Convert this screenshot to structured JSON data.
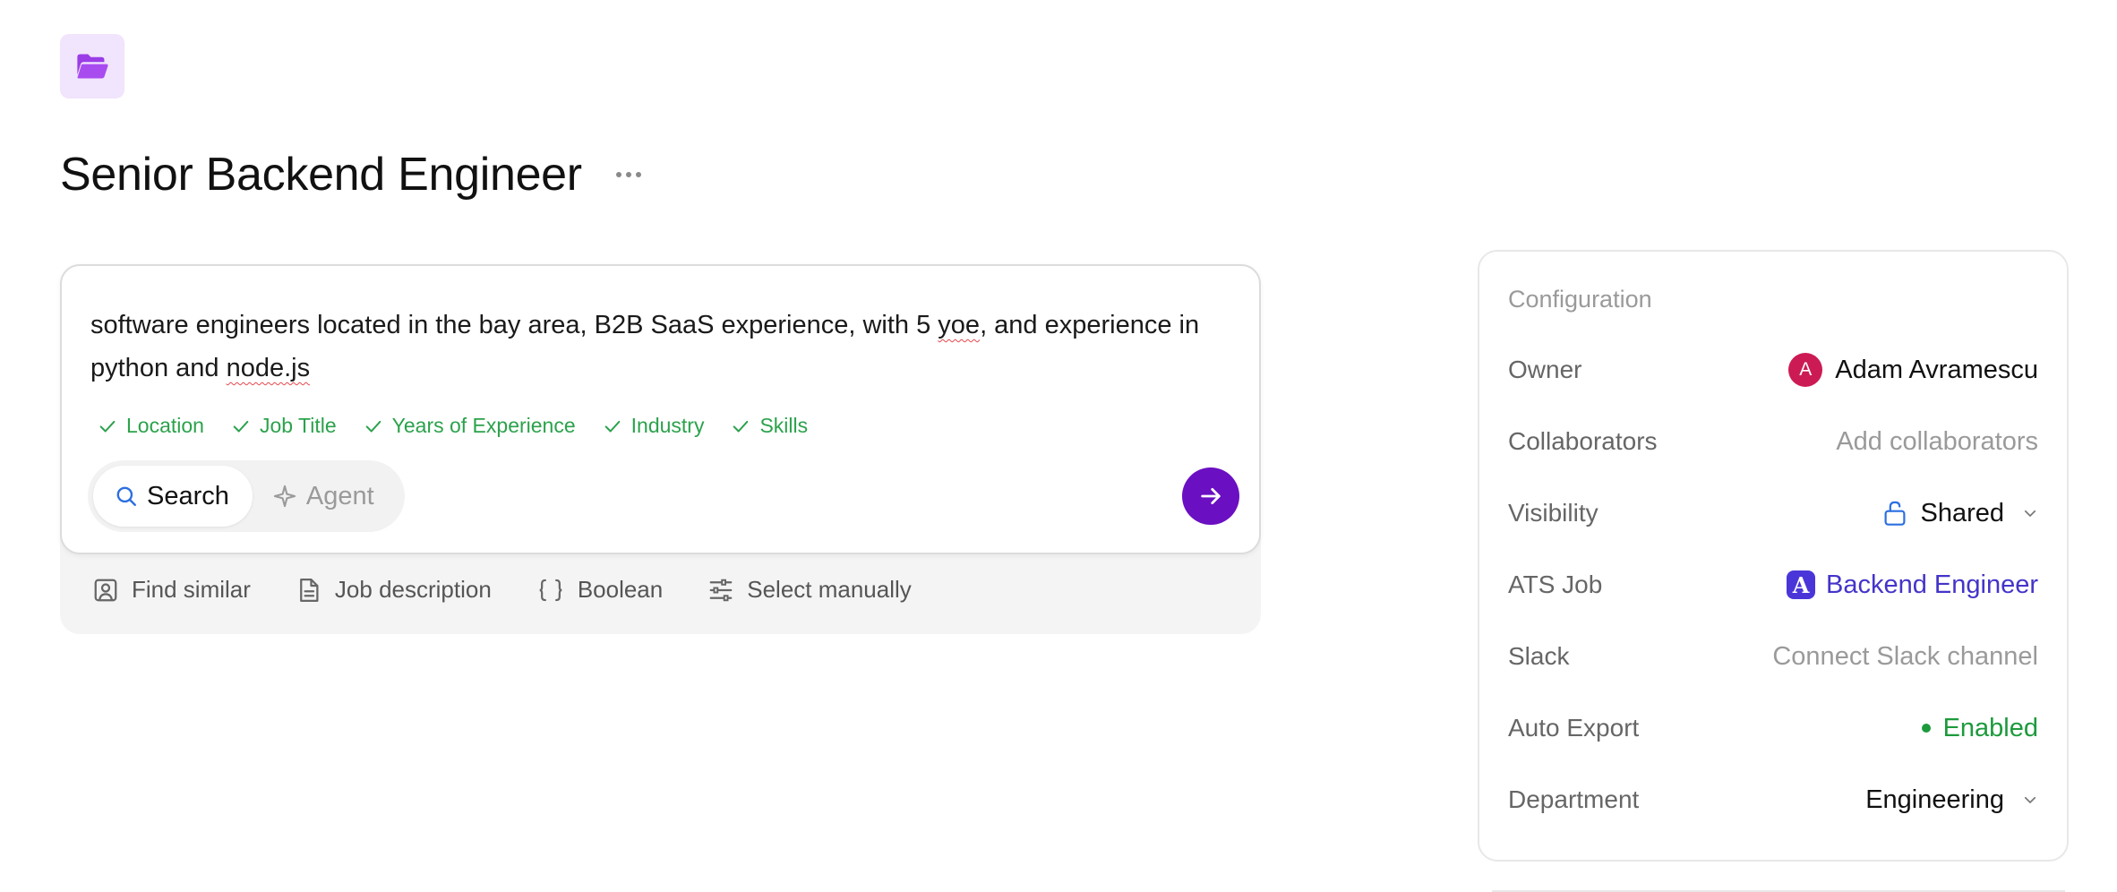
{
  "page": {
    "title": "Senior Backend Engineer"
  },
  "search": {
    "query_parts": [
      "software engineers located in the bay area, B2B SaaS experience, with 5 ",
      "yoe",
      ", and experience in python and ",
      "node.js"
    ],
    "criteria": [
      "Location",
      "Job Title",
      "Years of Experience",
      "Industry",
      "Skills"
    ],
    "modes": {
      "search": "Search",
      "agent": "Agent"
    },
    "tools": {
      "find_similar": "Find similar",
      "job_description": "Job description",
      "boolean": "Boolean",
      "select_manually": "Select manually"
    }
  },
  "config": {
    "header": "Configuration",
    "owner_label": "Owner",
    "owner_initial": "A",
    "owner_name": "Adam Avramescu",
    "collaborators_label": "Collaborators",
    "collaborators_value": "Add collaborators",
    "visibility_label": "Visibility",
    "visibility_value": "Shared",
    "ats_label": "ATS Job",
    "ats_logo_letter": "A",
    "ats_value": "Backend Engineer",
    "slack_label": "Slack",
    "slack_value": "Connect Slack channel",
    "export_label": "Auto Export",
    "export_value": "Enabled",
    "department_label": "Department",
    "department_value": "Engineering"
  },
  "colors": {
    "accent_purple": "#6b0fc2",
    "criteria_green": "#2ba24c",
    "ats_blue": "#4434c9",
    "owner_avatar": "#cc1b54"
  },
  "icons": {
    "header": "folder-open-icon",
    "more": "more-dots-icon",
    "check": "check-icon",
    "search": "search-icon",
    "agent": "sparkle-icon",
    "send": "arrow-right-icon",
    "find_similar": "user-portrait-icon",
    "job_description": "document-icon",
    "boolean": "braces-icon",
    "select_manually": "sliders-icon",
    "visibility": "unlock-icon",
    "dropdown": "chevron-down-icon"
  }
}
